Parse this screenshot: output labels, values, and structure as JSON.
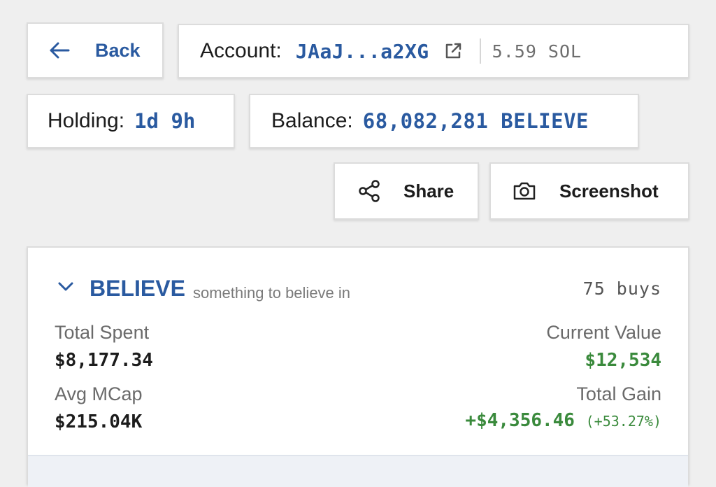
{
  "nav": {
    "back_label": "Back"
  },
  "account": {
    "label": "Account:",
    "address": "JAaJ...a2XG",
    "sol_balance": "5.59 SOL"
  },
  "holding": {
    "label": "Holding:",
    "value": "1d 9h"
  },
  "balance": {
    "label": "Balance:",
    "value": "68,082,281 BELIEVE"
  },
  "actions": {
    "share_label": "Share",
    "screenshot_label": "Screenshot"
  },
  "token": {
    "symbol": "BELIEVE",
    "description": "something to believe in",
    "buys": "75 buys",
    "total_spent_label": "Total Spent",
    "total_spent": "$8,177.34",
    "current_value_label": "Current Value",
    "current_value": "$12,534",
    "avg_mcap_label": "Avg MCap",
    "avg_mcap": "$215.04K",
    "total_gain_label": "Total Gain",
    "total_gain": "+$4,356.46",
    "total_gain_pct": "(+53.27%)"
  },
  "colors": {
    "accent": "#2a5aa0",
    "gain": "#3a8a3c",
    "background": "#efefef"
  },
  "icons": [
    "arrow-left-icon",
    "external-link-icon",
    "share-icon",
    "camera-icon",
    "chevron-down-icon"
  ]
}
